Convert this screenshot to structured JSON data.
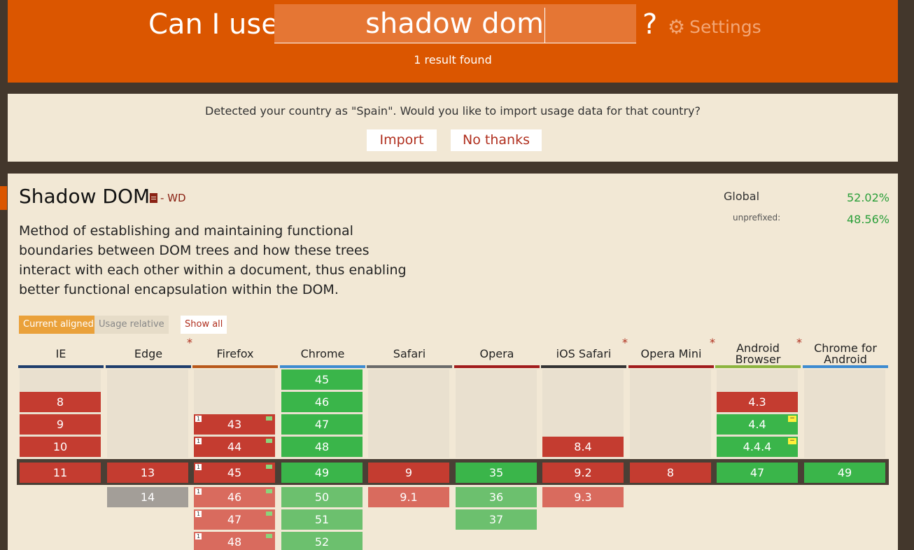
{
  "header": {
    "prefix": "Can I use",
    "query": "shadow dom",
    "qmark": "?",
    "settings_label": "Settings",
    "results": "1 result found"
  },
  "country_banner": {
    "message": "Detected your country as \"Spain\". Would you like to import usage data for that country?",
    "import_label": "Import",
    "no_thanks_label": "No thanks"
  },
  "feature": {
    "title": "Shadow DOM",
    "spec": "- WD",
    "description": "Method of establishing and maintaining functional boundaries between DOM trees and how these trees interact with each other within a document, thus enabling better functional encapsulation within the DOM.",
    "usage": {
      "global_label": "Global",
      "global_value": "52.02%",
      "unprefixed_label": "unprefixed:",
      "unprefixed_value": "48.56%"
    },
    "buttons": {
      "current_aligned": "Current aligned",
      "usage_relative": "Usage relative",
      "show_all": "Show all"
    }
  },
  "colors": {
    "header_bg": "#db5600",
    "panel_bg": "#f2e8d5",
    "supported": "#3ab54a",
    "unsupported": "#c43c30",
    "partial": "#ffef3a"
  },
  "browsers": [
    {
      "name": "IE",
      "star": "",
      "bar": "#1f3e6d",
      "cells": [
        {
          "v": "8",
          "s": "red",
          "r": 1
        },
        {
          "v": "9",
          "s": "red",
          "r": 2
        },
        {
          "v": "10",
          "s": "red",
          "r": 3
        },
        {
          "v": "11",
          "s": "red",
          "r": 4
        }
      ]
    },
    {
      "name": "Edge",
      "star": "*",
      "bar": "#1f3e6d",
      "cells": [
        {
          "v": "13",
          "s": "red",
          "r": 4
        },
        {
          "v": "14",
          "s": "gray",
          "r": 5
        }
      ]
    },
    {
      "name": "Firefox",
      "star": "",
      "bar": "#b9581a",
      "cells": [
        {
          "v": "43",
          "s": "red",
          "r": 2,
          "n": "1",
          "f": true
        },
        {
          "v": "44",
          "s": "red",
          "r": 3,
          "n": "1",
          "f": true
        },
        {
          "v": "45",
          "s": "red",
          "r": 4,
          "n": "1",
          "f": true
        },
        {
          "v": "46",
          "s": "lred",
          "r": 5,
          "n": "1",
          "f": true
        },
        {
          "v": "47",
          "s": "lred",
          "r": 6,
          "n": "1",
          "f": true
        },
        {
          "v": "48",
          "s": "lred",
          "r": 7,
          "n": "1",
          "f": true
        }
      ]
    },
    {
      "name": "Chrome",
      "star": "",
      "bar": "#3d8bd1",
      "cells": [
        {
          "v": "45",
          "s": "green",
          "r": 0
        },
        {
          "v": "46",
          "s": "green",
          "r": 1
        },
        {
          "v": "47",
          "s": "green",
          "r": 2
        },
        {
          "v": "48",
          "s": "green",
          "r": 3
        },
        {
          "v": "49",
          "s": "green",
          "r": 4
        },
        {
          "v": "50",
          "s": "lgreen",
          "r": 5
        },
        {
          "v": "51",
          "s": "lgreen",
          "r": 6
        },
        {
          "v": "52",
          "s": "lgreen",
          "r": 7
        }
      ]
    },
    {
      "name": "Safari",
      "star": "",
      "bar": "#6b6b6b",
      "cells": [
        {
          "v": "9",
          "s": "red",
          "r": 4
        },
        {
          "v": "9.1",
          "s": "lred",
          "r": 5
        }
      ]
    },
    {
      "name": "Opera",
      "star": "",
      "bar": "#a11c1c",
      "cells": [
        {
          "v": "35",
          "s": "green",
          "r": 4
        },
        {
          "v": "36",
          "s": "lgreen",
          "r": 5
        },
        {
          "v": "37",
          "s": "lgreen",
          "r": 6
        }
      ]
    },
    {
      "name": "iOS Safari",
      "star": "*",
      "bar": "#333333",
      "cells": [
        {
          "v": "8.4",
          "s": "red",
          "r": 3
        },
        {
          "v": "9.2",
          "s": "red",
          "r": 4
        },
        {
          "v": "9.3",
          "s": "lred",
          "r": 5
        }
      ]
    },
    {
      "name": "Opera Mini",
      "star": "*",
      "bar": "#a11c1c",
      "cells": [
        {
          "v": "8",
          "s": "red",
          "r": 4
        }
      ]
    },
    {
      "name": "Android Browser",
      "star": "*",
      "bar": "#8cb43e",
      "cells": [
        {
          "v": "4.3",
          "s": "red",
          "r": 1
        },
        {
          "v": "4.4",
          "s": "green",
          "r": 2,
          "p": true
        },
        {
          "v": "4.4.4",
          "s": "green",
          "r": 3,
          "p": true
        },
        {
          "v": "47",
          "s": "green",
          "r": 4
        }
      ]
    },
    {
      "name": "Chrome for Android",
      "star": "",
      "bar": "#3d8bd1",
      "cells": [
        {
          "v": "49",
          "s": "green",
          "r": 4
        }
      ]
    }
  ]
}
